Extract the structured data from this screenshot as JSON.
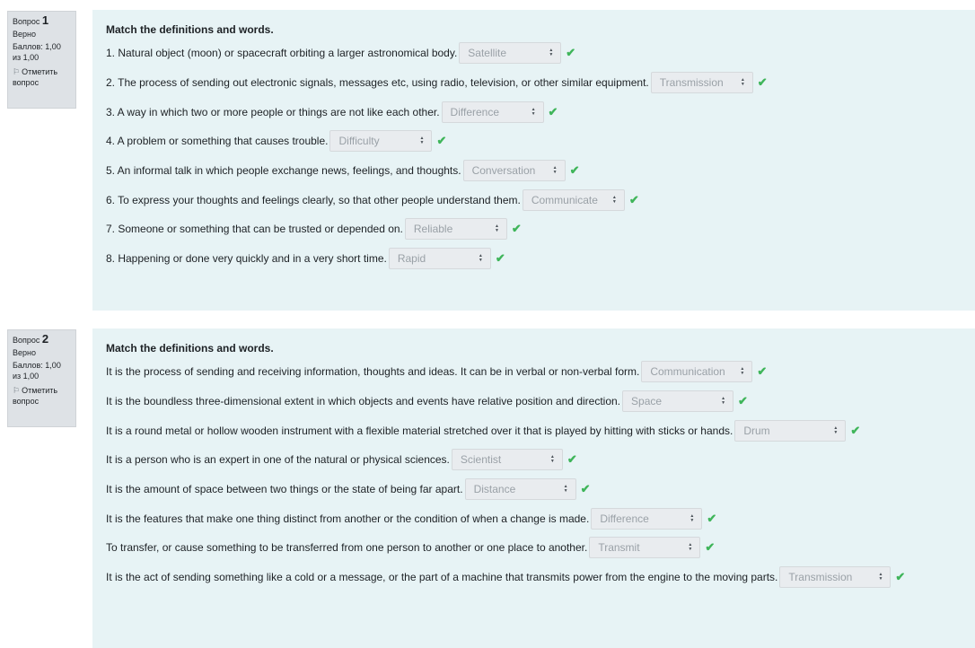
{
  "questions": [
    {
      "number_label": "Вопрос",
      "number": "1",
      "status": "Верно",
      "score": "Баллов: 1,00 из 1,00",
      "flag_label": "Отметить вопрос",
      "prompt": "Match the definitions and words.",
      "items": [
        {
          "text": "1. Natural object (moon) or spacecraft orbiting a larger astronomical body.",
          "answer": "Satellite"
        },
        {
          "text": "2. The process of sending out electronic signals, messages etc, using radio, television, or other similar equipment.",
          "answer": "Transmission"
        },
        {
          "text": "3. A way in which two or more people or things are not like each other.",
          "answer": "Difference"
        },
        {
          "text": "4. A problem or something that causes trouble.",
          "answer": "Difficulty"
        },
        {
          "text": "5. An informal talk in which people exchange news, feelings, and thoughts.",
          "answer": "Conversation"
        },
        {
          "text": "6. To express your thoughts and feelings clearly, so that other people understand them.",
          "answer": "Communicate"
        },
        {
          "text": "7. Someone or something that can be trusted or depended on.",
          "answer": "Reliable"
        },
        {
          "text": "8. Happening or done very quickly and in a very short time.",
          "answer": "Rapid"
        }
      ]
    },
    {
      "number_label": "Вопрос",
      "number": "2",
      "status": "Верно",
      "score": "Баллов: 1,00 из 1,00",
      "flag_label": "Отметить вопрос",
      "prompt": "Match the definitions and words.",
      "items": [
        {
          "text": " It is the process of sending and receiving information, thoughts and ideas. It can be in verbal or non-verbal form.",
          "answer": "Communication"
        },
        {
          "text": "It is the boundless three-dimensional extent in which objects and events have relative position and direction.",
          "answer": "Space"
        },
        {
          "text": "It is a round metal or hollow wooden instrument with a flexible material stretched over it that is played by hitting with sticks or hands.",
          "answer": "Drum"
        },
        {
          "text": "It is a person who is an expert in one of the natural or physical sciences.",
          "answer": "Scientist"
        },
        {
          "text": "It is the amount of space between two things or the state of being far apart.",
          "answer": "Distance"
        },
        {
          "text": "It is the features that make one thing distinct from another or the condition of when a change is made.",
          "answer": "Difference"
        },
        {
          "text": "To transfer, or cause something to be transferred from one person to another or one place to another.",
          "answer": "Transmit"
        },
        {
          "text": "It is the act of sending something like a cold or a message, or the part of a machine that transmits power from the engine to the moving parts.",
          "answer": "Transmission"
        }
      ]
    }
  ],
  "colors": {
    "panel": "#e7f3f5",
    "info": "#dee2e6",
    "check": "#3fb55a"
  },
  "icons": {
    "flag": "flag-icon",
    "check": "check-icon",
    "select": "updown-caret-icon"
  }
}
